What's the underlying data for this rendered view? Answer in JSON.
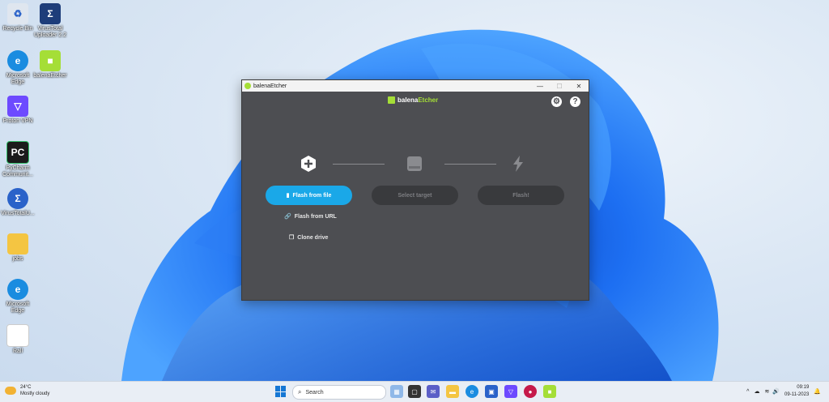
{
  "desktop": {
    "icons": [
      {
        "label": "Recycle Bin",
        "icon": "recycle-bin-icon",
        "color": "#dfe6ef"
      },
      {
        "label": "VirusTotal Uploader 2.2",
        "icon": "virustotal-icon",
        "color": "#1e3d7a"
      },
      {
        "label": "Microsoft Edge",
        "icon": "edge-icon",
        "color": "#1a8ce0"
      },
      {
        "label": "balenaEtcher",
        "icon": "balena-icon",
        "color": "#a5de37"
      },
      {
        "label": "Proton VPN",
        "icon": "protonvpn-icon",
        "color": "#6d4aff"
      },
      {
        "label": "PyCharm Communit...",
        "icon": "pycharm-icon",
        "color": "#1b1b1b"
      },
      {
        "label": "VirusTotalU...",
        "icon": "virustotal-icon",
        "color": "#2a62c9"
      },
      {
        "label": "jobs",
        "icon": "folder-icon",
        "color": "#f4c542"
      },
      {
        "label": "Microsoft Edge",
        "icon": "edge-icon",
        "color": "#1a8ce0"
      },
      {
        "label": "Rall",
        "icon": "file-icon",
        "color": "#ffffff"
      }
    ]
  },
  "window": {
    "title": "balenaEtcher",
    "logo_prefix": "balena",
    "logo_suffix": "Etcher",
    "buttons": {
      "flash_from_file": "Flash from file",
      "select_target": "Select target",
      "flash": "Flash!"
    },
    "links": {
      "flash_from_url": "Flash from URL",
      "clone_drive": "Clone drive"
    },
    "accent_color": "#1aa8e8",
    "brand_color": "#a5de37"
  },
  "taskbar": {
    "weather_temp": "24°C",
    "weather_desc": "Mostly cloudy",
    "search_placeholder": "Search",
    "time": "09:19",
    "date": "09-11-2023"
  }
}
